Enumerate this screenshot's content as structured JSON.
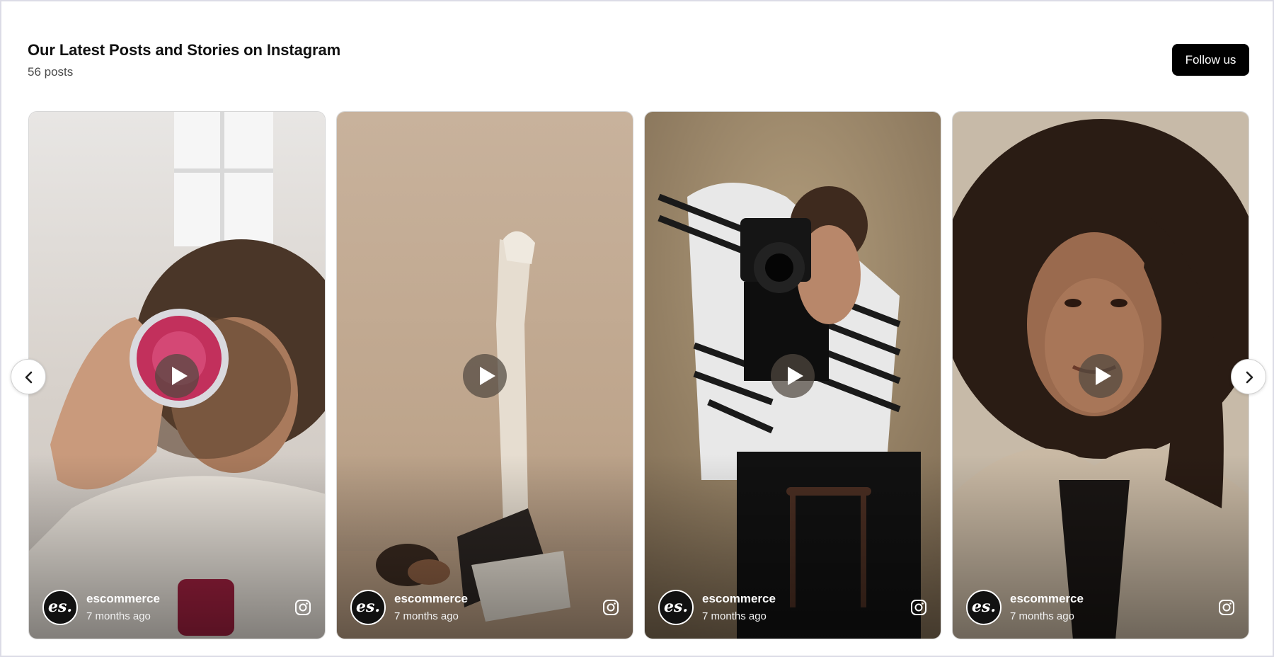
{
  "header": {
    "title": "Our Latest Posts and Stories on Instagram",
    "post_count": "56 posts",
    "follow_label": "Follow us"
  },
  "posts": [
    {
      "username": "escommerce",
      "time": "7 months ago",
      "avatar_text": "es."
    },
    {
      "username": "escommerce",
      "time": "7 months ago",
      "avatar_text": "es."
    },
    {
      "username": "escommerce",
      "time": "7 months ago",
      "avatar_text": "es."
    },
    {
      "username": "escommerce",
      "time": "7 months ago",
      "avatar_text": "es."
    }
  ],
  "icons": {
    "play": "play-icon",
    "instagram": "instagram-icon",
    "prev": "chevron-left-icon",
    "next": "chevron-right-icon"
  },
  "colors": {
    "follow_button_bg": "#000000",
    "background": "#ffffff",
    "border": "#dcdce6"
  }
}
